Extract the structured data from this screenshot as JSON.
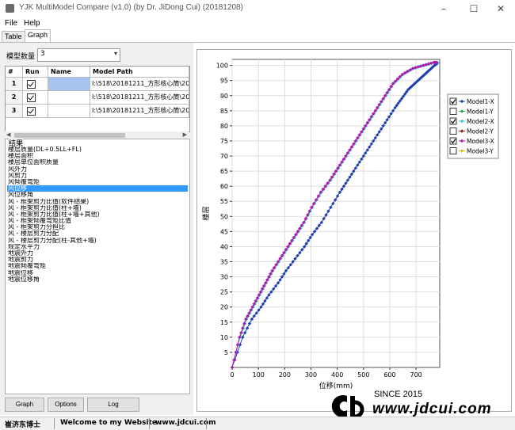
{
  "window": {
    "title": "YJK MultiModel Compare (v1.0) (by Dr. JiDong Cui) (20181208)",
    "minimize": "–",
    "maximize": "☐",
    "close": "✕"
  },
  "menu": {
    "file": "File",
    "help": "Help"
  },
  "tabs": [
    {
      "label": "Table"
    },
    {
      "label": "Graph"
    }
  ],
  "active_tab": "Graph",
  "model_count": {
    "label": "模型数量",
    "value": "3"
  },
  "model_grid": {
    "headers": [
      "#",
      "Run",
      "Name",
      "Model Path"
    ],
    "rows": [
      {
        "num": "1",
        "run": true,
        "name": "",
        "path": "I:\\518\\20181211_方形核心筒\\20"
      },
      {
        "num": "2",
        "run": true,
        "name": "",
        "path": "I:\\518\\20181211_方形核心筒\\20"
      },
      {
        "num": "3",
        "run": true,
        "name": "",
        "path": "I:\\518\\20181211_方形核心筒\\20"
      }
    ]
  },
  "results": {
    "title": "结果",
    "selected_index": 6,
    "items": [
      "楼层质量(DL+0.5LL+FL)",
      "楼层面积",
      "楼层单位面积质量",
      "风外力",
      "风剪力",
      "风倾覆弯矩",
      "风位移",
      "风位移角",
      "风 - 框架剪力比值(软件结果)",
      "风 - 框架剪力比值(柱+墙)",
      "风 - 框架剪力比值(柱+墙+其他)",
      "风 - 框架倾覆弯矩比值",
      "风 - 框架剪力分担比",
      "风 - 楼层剪力分配",
      "风 - 楼层剪力分配(柱-其他+墙)",
      "规定水平力",
      "地震外力",
      "地震剪力",
      "地震倾覆弯矩",
      "地震位移",
      "地震位移角"
    ]
  },
  "buttons": {
    "graph": "Graph",
    "options": "Options",
    "log": "Log"
  },
  "status": {
    "author": "崔济东博士",
    "welcome": "Welcome to my Website :",
    "site": "www.jdcui.com"
  },
  "watermark": {
    "since": "SINCE 2015",
    "url": "www.jdcui.com"
  },
  "chart_data": {
    "type": "line",
    "xlabel": "位移(mm)",
    "ylabel": "楼层",
    "xlim": [
      0,
      790
    ],
    "ylim": [
      0,
      102
    ],
    "xticks": [
      0,
      100,
      200,
      300,
      400,
      500,
      600,
      700
    ],
    "yticks": [
      5,
      10,
      15,
      20,
      25,
      30,
      35,
      40,
      45,
      50,
      55,
      60,
      65,
      70,
      75,
      80,
      85,
      90,
      95,
      100
    ],
    "grid": true,
    "legend_position": "right",
    "series": [
      {
        "name": "Model1-X",
        "visible": true,
        "color": "#1f3fb0",
        "marker": "diamond",
        "x": [
          0,
          40,
          75,
          110,
          140,
          175,
          205,
          240,
          275,
          305,
          340,
          375,
          410,
          440,
          470,
          500,
          530,
          560,
          590,
          620,
          645,
          670,
          695,
          720,
          745,
          770,
          785
        ],
        "y": [
          0,
          10,
          16,
          20,
          24,
          28,
          32,
          36,
          40,
          44,
          48,
          53,
          58,
          62,
          66,
          70,
          74,
          78,
          82,
          86,
          89,
          92,
          94,
          96,
          98,
          100,
          101
        ]
      },
      {
        "name": "Model1-Y",
        "visible": false,
        "color": "#30a050",
        "marker": "diamond"
      },
      {
        "name": "Model2-X",
        "visible": true,
        "color": "#3cc8c8",
        "marker": "diamond",
        "x": [
          0,
          30,
          55,
          80,
          105,
          130,
          155,
          185,
          215,
          245,
          275,
          305,
          340,
          375,
          405,
          435,
          465,
          495,
          525,
          555,
          585,
          615,
          650,
          690,
          730,
          770,
          785
        ],
        "y": [
          0,
          10,
          16,
          20,
          24,
          28,
          32,
          36,
          40,
          44,
          48,
          53,
          58,
          62,
          66,
          70,
          74,
          78,
          82,
          86,
          90,
          94,
          97,
          99,
          100,
          101,
          101
        ]
      },
      {
        "name": "Model2-Y",
        "visible": false,
        "color": "#8b1a1a",
        "marker": "diamond"
      },
      {
        "name": "Model3-X",
        "visible": true,
        "color": "#b01ab0",
        "marker": "diamond",
        "x": [
          0,
          28,
          52,
          77,
          102,
          127,
          152,
          182,
          212,
          242,
          272,
          302,
          337,
          372,
          402,
          432,
          462,
          492,
          522,
          552,
          582,
          612,
          647,
          687,
          727,
          767,
          782
        ],
        "y": [
          0,
          10,
          16,
          20,
          24,
          28,
          32,
          36,
          40,
          44,
          48,
          53,
          58,
          62,
          66,
          70,
          74,
          78,
          82,
          86,
          90,
          94,
          97,
          99,
          100,
          101,
          101
        ]
      },
      {
        "name": "Model3-Y",
        "visible": false,
        "color": "#d8c800",
        "marker": "diamond"
      }
    ]
  }
}
